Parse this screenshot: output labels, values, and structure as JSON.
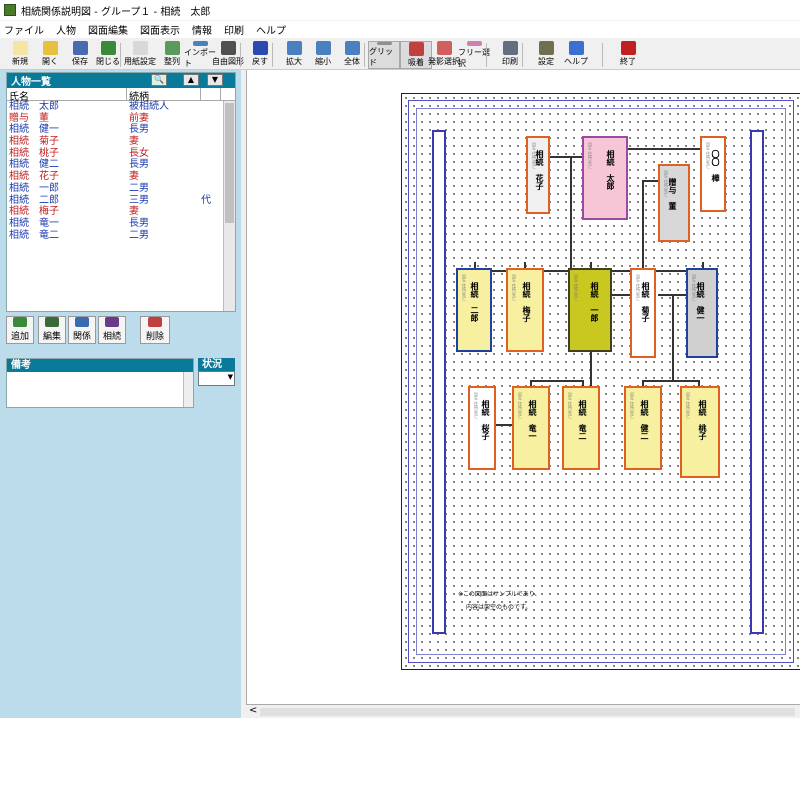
{
  "window": {
    "title": "相続関係説明図 - グループ１ - 相続　太郎"
  },
  "menu": [
    "ファイル",
    "人物",
    "図面編集",
    "図面表示",
    "情報",
    "印刷",
    "ヘルプ"
  ],
  "toolbar": [
    {
      "label": "新規",
      "color": "#f4e6a0"
    },
    {
      "label": "開く",
      "color": "#e8c040"
    },
    {
      "label": "保存",
      "color": "#4a6ab0"
    },
    {
      "label": "閉じる",
      "color": "#3a8a3a"
    },
    {
      "label": "用紙設定",
      "color": "#d8d8d8"
    },
    {
      "label": "整列",
      "color": "#5a9a5a"
    },
    {
      "label": "インポート",
      "color": "#4a80c0"
    },
    {
      "label": "自由図形",
      "color": "#505050"
    },
    {
      "label": "戻す",
      "color": "#2a4ab0"
    },
    {
      "label": "拡大",
      "color": "#4a80c0"
    },
    {
      "label": "縮小",
      "color": "#4a80c0"
    },
    {
      "label": "全体",
      "color": "#4a80c0"
    },
    {
      "label": "グリッド",
      "color": "#909090"
    },
    {
      "label": "吸着",
      "color": "#c04040"
    },
    {
      "label": "発影選択",
      "color": "#d06060"
    },
    {
      "label": "フリー選択",
      "color": "#d080b0"
    },
    {
      "label": "印刷",
      "color": "#607080"
    },
    {
      "label": "設定",
      "color": "#707050"
    },
    {
      "label": "ヘルプ",
      "color": "#3a70d0"
    },
    {
      "label": "終了",
      "color": "#c02020"
    }
  ],
  "person_list": {
    "title": "人物一覧",
    "search_icon": "magnifier-icon",
    "columns": [
      "氏名",
      "続柄"
    ],
    "rows": [
      {
        "name": "相続　太郎",
        "relation": "被相続人",
        "extra": "",
        "color": "#1a3ab0"
      },
      {
        "name": "贈与　董",
        "relation": "前妻",
        "extra": "",
        "color": "#c02020"
      },
      {
        "name": "相続　健一",
        "relation": "長男",
        "extra": "",
        "color": "#1a3ab0"
      },
      {
        "name": "相続　菊子",
        "relation": "妻",
        "extra": "",
        "color": "#c02020"
      },
      {
        "name": "相続　桃子",
        "relation": "長女",
        "extra": "",
        "color": "#c02020"
      },
      {
        "name": "相続　健二",
        "relation": "長男",
        "extra": "",
        "color": "#1a3ab0"
      },
      {
        "name": "相続　花子",
        "relation": "妻",
        "extra": "",
        "color": "#c02020"
      },
      {
        "name": "相続　一郎",
        "relation": "二男",
        "extra": "",
        "color": "#1a3ab0"
      },
      {
        "name": "相続　二郎",
        "relation": "三男",
        "extra": "代",
        "color": "#1a3ab0"
      },
      {
        "name": "相続　梅子",
        "relation": "妻",
        "extra": "",
        "color": "#c02020"
      },
      {
        "name": "相続　竜一",
        "relation": "長男",
        "extra": "",
        "color": "#1a3ab0"
      },
      {
        "name": "相続　竜二",
        "relation": "二男",
        "extra": "",
        "color": "#1a3ab0"
      }
    ]
  },
  "actions": [
    "追加",
    "編集",
    "関係",
    "相続",
    "削除"
  ],
  "bikou": {
    "title": "備考"
  },
  "joukyou": {
    "title": "状況"
  },
  "diagram": {
    "cards": [
      {
        "id": "hanako",
        "name": "相続　花子",
        "border": "#e06020",
        "fill": "#f0f0f0"
      },
      {
        "id": "taro",
        "name": "相続　太郎",
        "border": "#9a4aa0",
        "fill": "#f6c6d6"
      },
      {
        "id": "oo",
        "name": "〇〇　樺",
        "border": "#e06020",
        "fill": "#ffffff"
      },
      {
        "id": "tadashi",
        "name": "贈与　董",
        "border": "#e06020",
        "fill": "#d8d8d8"
      },
      {
        "id": "jiro",
        "name": "相続　二郎",
        "border": "#2040a0",
        "fill": "#f6f0a0"
      },
      {
        "id": "umeko",
        "name": "相続　梅子",
        "border": "#e06020",
        "fill": "#f6f0a0"
      },
      {
        "id": "ichiro",
        "name": "相続　一郎",
        "border": "#404020",
        "fill": "#c8c820"
      },
      {
        "id": "kikuko",
        "name": "相続　菊子",
        "border": "#e06020",
        "fill": "#ffffff"
      },
      {
        "id": "kenichi",
        "name": "相続　健一",
        "border": "#2040a0",
        "fill": "#d0d0d0"
      },
      {
        "id": "momoko_s",
        "name": "相続　桜子",
        "border": "#e06020",
        "fill": "#ffffff"
      },
      {
        "id": "ryuichi",
        "name": "相続　竜一",
        "border": "#e06020",
        "fill": "#f6f0a0"
      },
      {
        "id": "ryuji",
        "name": "相続　竜二",
        "border": "#e06020",
        "fill": "#f6f0a0"
      },
      {
        "id": "kenji",
        "name": "相続　健二",
        "border": "#e06020",
        "fill": "#f6f0a0"
      },
      {
        "id": "momoko",
        "name": "相続　桃子",
        "border": "#e06020",
        "fill": "#f6f0a0"
      }
    ],
    "note1": "※この図面はサンプルであり、",
    "note2": "内容は架空のものです。"
  }
}
